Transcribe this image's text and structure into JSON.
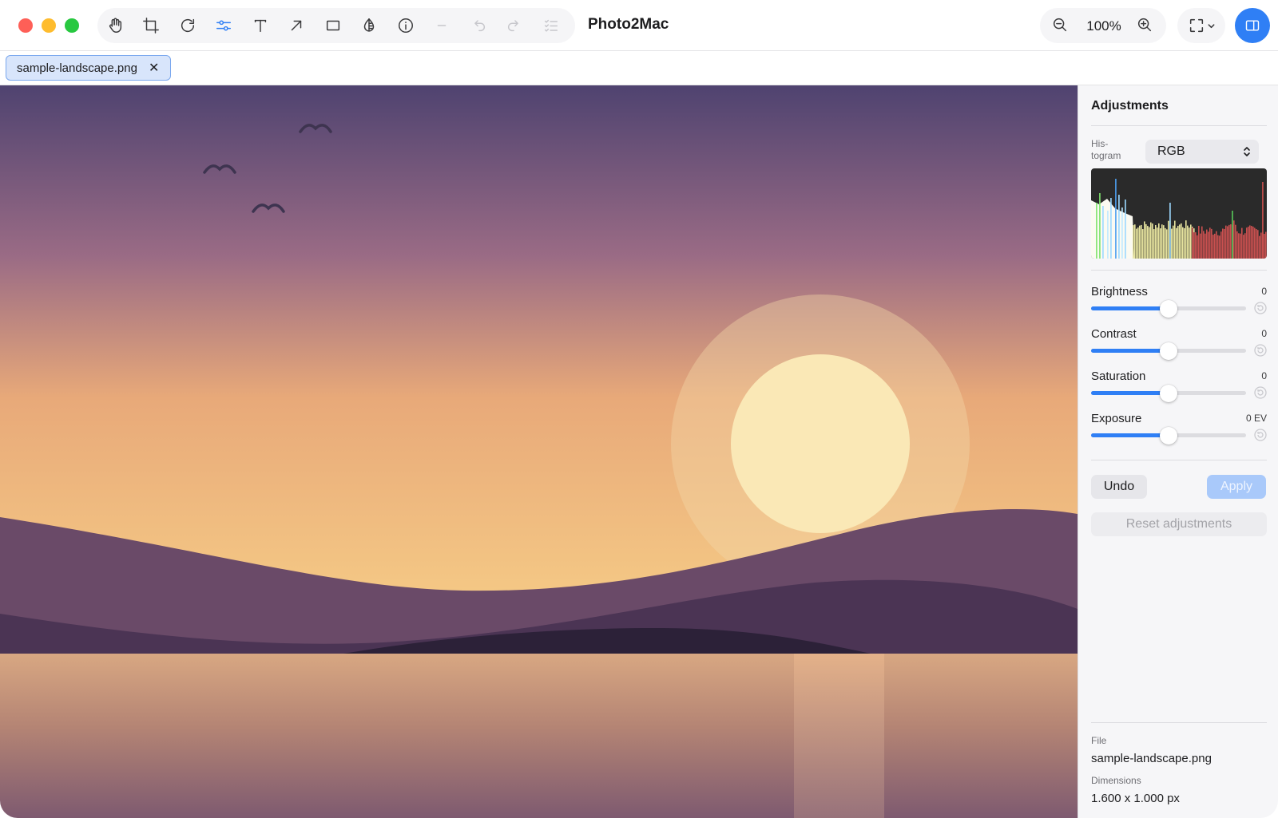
{
  "app": {
    "title": "Photo2Mac",
    "zoom": "100%"
  },
  "toolbar": {
    "tools": [
      {
        "name": "hand-tool",
        "icon": "hand-icon",
        "active": false,
        "enabled": true
      },
      {
        "name": "crop-tool",
        "icon": "crop-icon",
        "active": false,
        "enabled": true
      },
      {
        "name": "rotate-tool",
        "icon": "rotate-icon",
        "active": false,
        "enabled": true
      },
      {
        "name": "adjust-tool",
        "icon": "sliders-icon",
        "active": true,
        "enabled": true
      },
      {
        "name": "text-tool",
        "icon": "text-icon",
        "active": false,
        "enabled": true
      },
      {
        "name": "arrow-tool",
        "icon": "arrow-icon",
        "active": false,
        "enabled": true
      },
      {
        "name": "rectangle-tool",
        "icon": "rectangle-icon",
        "active": false,
        "enabled": true
      },
      {
        "name": "redact-tool",
        "icon": "drop-halftone-icon",
        "active": false,
        "enabled": true
      },
      {
        "name": "info-tool",
        "icon": "info-icon",
        "active": false,
        "enabled": true
      },
      {
        "name": "line-width-tool",
        "icon": "line-icon",
        "active": false,
        "enabled": false
      },
      {
        "name": "undo-tool",
        "icon": "undo-icon",
        "active": false,
        "enabled": false
      },
      {
        "name": "redo-tool",
        "icon": "redo-icon",
        "active": false,
        "enabled": false
      },
      {
        "name": "checklist-tool",
        "icon": "checklist-icon",
        "active": false,
        "enabled": false
      }
    ]
  },
  "tabs": [
    {
      "label": "sample-landscape.png",
      "close": "✕",
      "active": true
    }
  ],
  "inspector": {
    "title": "Adjustments",
    "histogram_label": "His-\ntogram",
    "channel": "RGB",
    "adjustments": [
      {
        "key": "brightness",
        "label": "Brightness",
        "value": "0",
        "level": 0.5
      },
      {
        "key": "contrast",
        "label": "Contrast",
        "value": "0",
        "level": 0.5
      },
      {
        "key": "saturation",
        "label": "Saturation",
        "value": "0",
        "level": 0.5
      },
      {
        "key": "exposure",
        "label": "Exposure",
        "value": "0 EV",
        "level": 0.5
      }
    ],
    "undo_label": "Undo",
    "apply_label": "Apply",
    "reset_label": "Reset adjustments",
    "file_label": "File",
    "file_value": "sample-landscape.png",
    "dimensions_label": "Dimensions",
    "dimensions_value": "1.600 x 1.000 px"
  },
  "colors": {
    "accent": "#2f7ff5",
    "sky_top": "#4f4370",
    "sky_bottom": "#f7c97f",
    "sun": "#fae8b6",
    "hills": "#6a4a68",
    "water_top": "#d7a682"
  }
}
